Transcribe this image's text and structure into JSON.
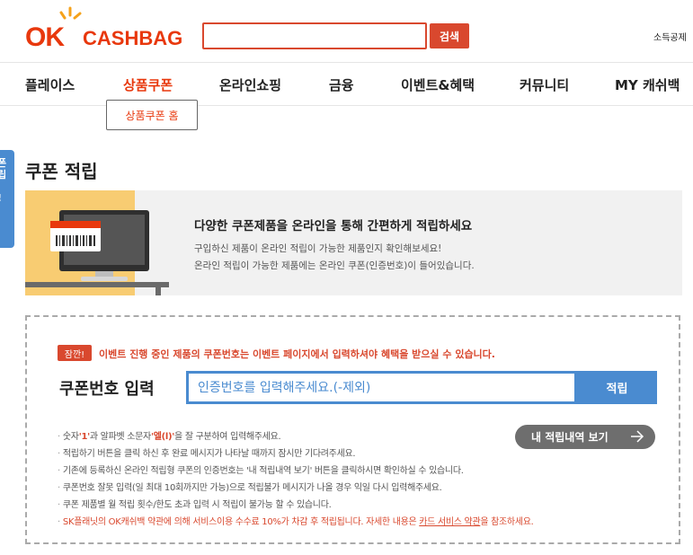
{
  "header": {
    "logo_ok": "OK",
    "logo_cashbag": "CASHBAG",
    "search_placeholder": "",
    "search_button": "검색",
    "top_link": "소득공제"
  },
  "nav": {
    "items": [
      {
        "label": "플레이스",
        "active": false
      },
      {
        "label": "상품쿠폰",
        "active": true
      },
      {
        "label": "온라인쇼핑",
        "active": false
      },
      {
        "label": "금융",
        "active": false
      },
      {
        "label": "이벤트&혜택",
        "active": false
      },
      {
        "label": "커뮤니티",
        "active": false
      },
      {
        "label": "MY 캐쉬백",
        "active": false
      }
    ],
    "submenu": "상품쿠폰 홈"
  },
  "side_tab": {
    "text": "폰\n립\n!"
  },
  "page": {
    "title": "쿠폰 적립"
  },
  "banner": {
    "heading": "다양한 쿠폰제품을 온라인을 통해 간편하게 적립하세요",
    "line1": "구입하신 제품이 온라인 적립이 가능한 제품인지 확인해보세요!",
    "line2": "온라인 적립이 가능한 제품에는 온라인 쿠폰(인증번호)이 들어있습니다."
  },
  "coupon": {
    "notice_badge": "잠깐!",
    "notice_text": "이벤트 진행 중인 제품의 쿠폰번호는 이벤트 페이지에서 입력하셔야 혜택을 받으실 수 있습니다.",
    "input_label": "쿠폰번호 입력",
    "input_placeholder": "인증번호를 입력해주세요.(-제외)",
    "submit_label": "적립",
    "history_label": "내 적립내역 보기",
    "guide": {
      "g1_pre": "숫자",
      "g1_one": "'1'",
      "g1_mid": "과 알파벳 소문자",
      "g1_el": "'엘(l)'",
      "g1_post": "을 잘 구분하여 입력해주세요.",
      "g2": "적립하기 버튼을 클릭 하신 후 완료 메시지가 나타날 때까지 잠시만 기다려주세요.",
      "g3": "기존에 등록하신 온라인 적립형 쿠폰의 인증번호는 '내 적립내역 보기' 버튼을 클릭하시면 확인하실 수 있습니다.",
      "g4": "쿠폰번호 잘못 입력(일 최대 10회까지만 가능)으로 적립불가 메시지가 나올 경우 익일 다시 입력해주세요.",
      "g5": "쿠폰 제품별 월 적립 횟수/한도 초과 입력 시 적립이 불가능 할 수 있습니다.",
      "g6_pre": "SK플래닛의 OK캐쉬백 약관에 의해 서비스이용 수수료 10%가 차감 후 적립됩니다. 자세한 내용은 ",
      "g6_link": "카드 서비스 약관",
      "g6_post": "을 참조하세요."
    }
  },
  "colors": {
    "brand_red": "#e8380d",
    "accent_blue": "#4a8bd0",
    "banner_yellow": "#f8cc72"
  }
}
